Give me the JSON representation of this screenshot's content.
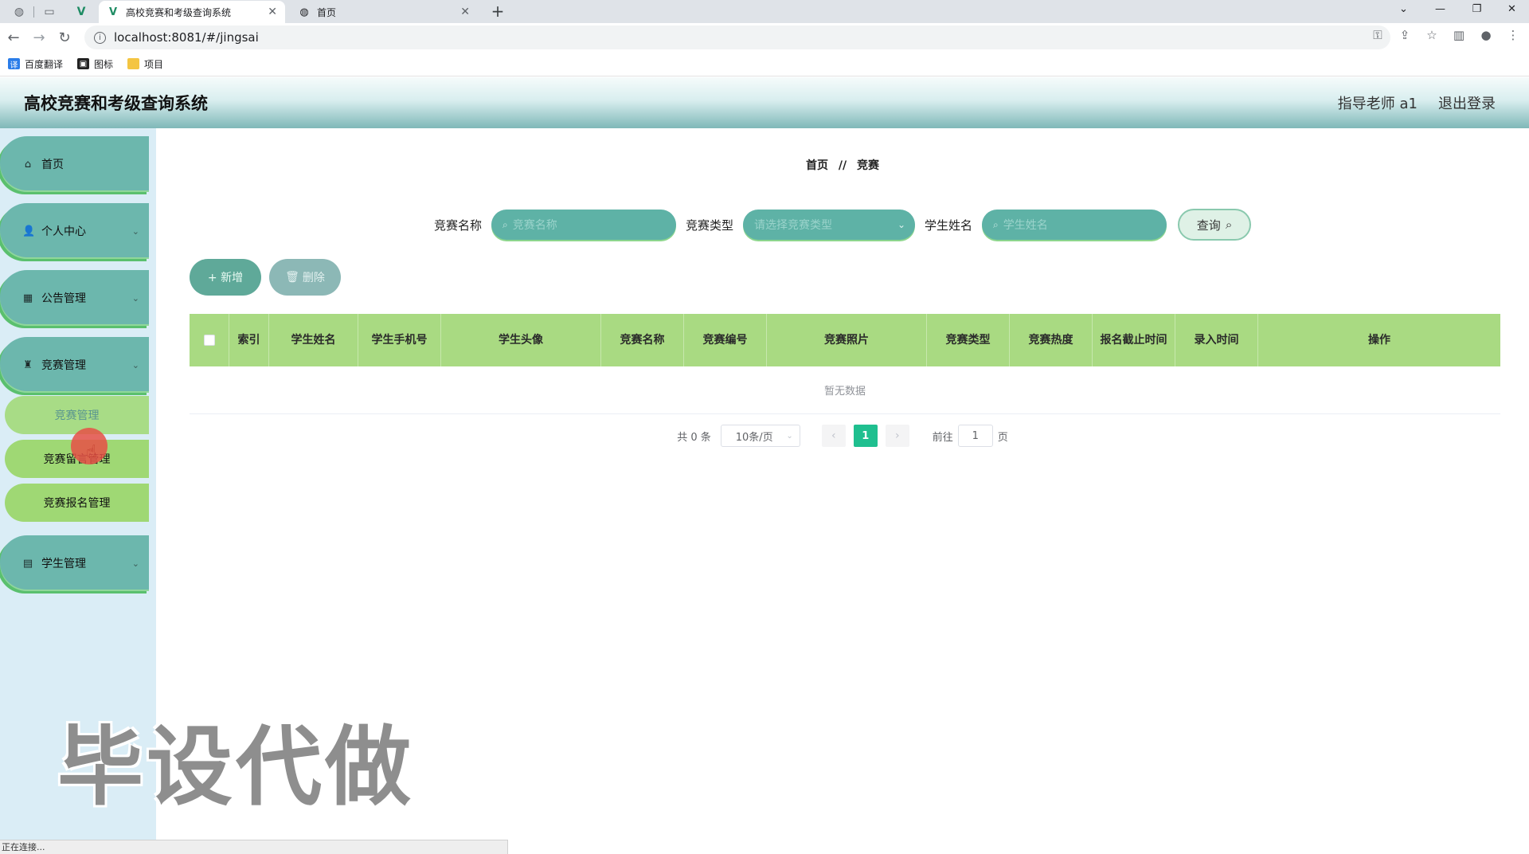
{
  "browser": {
    "tabs": [
      {
        "title": "高校竞赛和考级查询系统",
        "active": true
      },
      {
        "title": "首页",
        "active": false
      }
    ],
    "url": "localhost:8081/#/jingsai",
    "bookmarks": [
      "百度翻译",
      "图标",
      "项目"
    ],
    "status": "正在连接..."
  },
  "header": {
    "title": "高校竞赛和考级查询系统",
    "user": "指导老师 a1",
    "logout": "退出登录"
  },
  "sidebar": {
    "items": [
      {
        "label": "首页",
        "icon": "home-icon",
        "expandable": false
      },
      {
        "label": "个人中心",
        "icon": "user-icon",
        "expandable": true
      },
      {
        "label": "公告管理",
        "icon": "grid-icon",
        "expandable": true
      },
      {
        "label": "竞赛管理",
        "icon": "trophy-icon",
        "expandable": true
      },
      {
        "label": "学生管理",
        "icon": "clipboard-icon",
        "expandable": true
      }
    ],
    "subitems": [
      {
        "label": "竞赛管理",
        "active": true
      },
      {
        "label": "竞赛留言管理",
        "active": false
      },
      {
        "label": "竞赛报名管理",
        "active": false
      }
    ]
  },
  "breadcrumb": {
    "home": "首页",
    "separator": "//",
    "current": "竞赛"
  },
  "search": {
    "name_label": "竞赛名称",
    "name_placeholder": "竞赛名称",
    "type_label": "竞赛类型",
    "type_placeholder": "请选择竞赛类型",
    "student_label": "学生姓名",
    "student_placeholder": "学生姓名",
    "query_label": "查询"
  },
  "actions": {
    "add": "+ 新增",
    "delete": "删除"
  },
  "table": {
    "columns": [
      "索引",
      "学生姓名",
      "学生手机号",
      "学生头像",
      "竞赛名称",
      "竞赛编号",
      "竞赛照片",
      "竞赛类型",
      "竞赛热度",
      "报名截止时间",
      "录入时间",
      "操作"
    ],
    "empty_text": "暂无数据"
  },
  "pagination": {
    "total": "共 0 条",
    "page_size": "10条/页",
    "current_page": "1",
    "goto_label": "前往",
    "goto_value": "1",
    "page_suffix": "页"
  },
  "watermark": "毕设代做",
  "colors": {
    "header_teal": "#7fb8b8",
    "menu_teal": "#6cb7ad",
    "table_head": "#a9da82",
    "accent_green": "#1fbf8f"
  }
}
